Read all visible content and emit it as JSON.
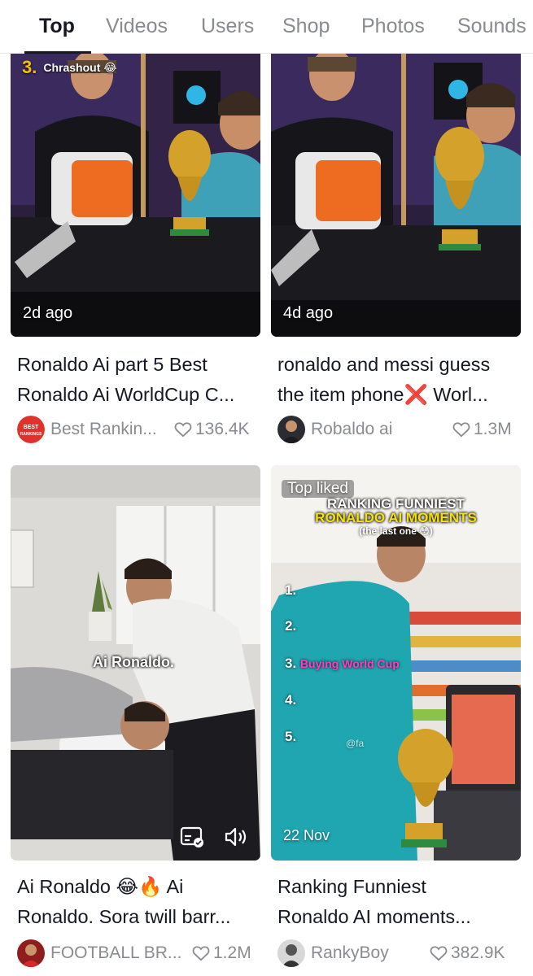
{
  "tabs": [
    {
      "label": "Top",
      "active": true
    },
    {
      "label": "Videos",
      "active": false
    },
    {
      "label": "Users",
      "active": false
    },
    {
      "label": "Shop",
      "active": false
    },
    {
      "label": "Photos",
      "active": false
    },
    {
      "label": "Sounds",
      "active": false
    }
  ],
  "videos": [
    {
      "overlay_rank": "3.",
      "overlay_channel": "Chrashout 😂",
      "timestamp": "2d ago",
      "caption_line1": "Ronaldo Ai part 5 Best",
      "caption_line2": "Ronaldo Ai WorldCup C...",
      "author": "Best Rankin...",
      "avatar_text": "BEST RANKINGS",
      "likes": "136.4K"
    },
    {
      "timestamp": "4d ago",
      "caption_line1": "ronaldo and messi guess",
      "caption_line2": "the item phone❌ Worl...",
      "author": "Robaldo ai",
      "likes": "1.3M"
    },
    {
      "overlay_subtitle": "Ai Ronaldo.",
      "caption_line1": "Ai Ronaldo 😂🔥 Ai",
      "caption_line2": "Ronaldo. Sora twill barr...",
      "author": "FOOTBALL BR...",
      "likes": "1.2M",
      "icons": [
        "captions-icon",
        "volume-icon"
      ]
    },
    {
      "top_label": "Top liked",
      "banner_line1": "RANKING FUNNIEST",
      "banner_line2": "RONALDO AI MOMENTS",
      "banner_line3": "(the last one 😳)",
      "list": [
        "1.",
        "2.",
        "3.",
        "4.",
        "5."
      ],
      "list_item3_text": "Buying World Cup",
      "watermark": "@fa",
      "timestamp": "22 Nov",
      "caption_line1": "Ranking Funniest",
      "caption_line2": "Ronaldo AI moments...",
      "author": "RankyBoy",
      "likes": "382.9K"
    }
  ],
  "colors": {
    "text_primary": "#161823",
    "text_secondary": "#8a8b91",
    "banner_yellow": "#f5e200",
    "list_pink": "#ff3cc7"
  }
}
